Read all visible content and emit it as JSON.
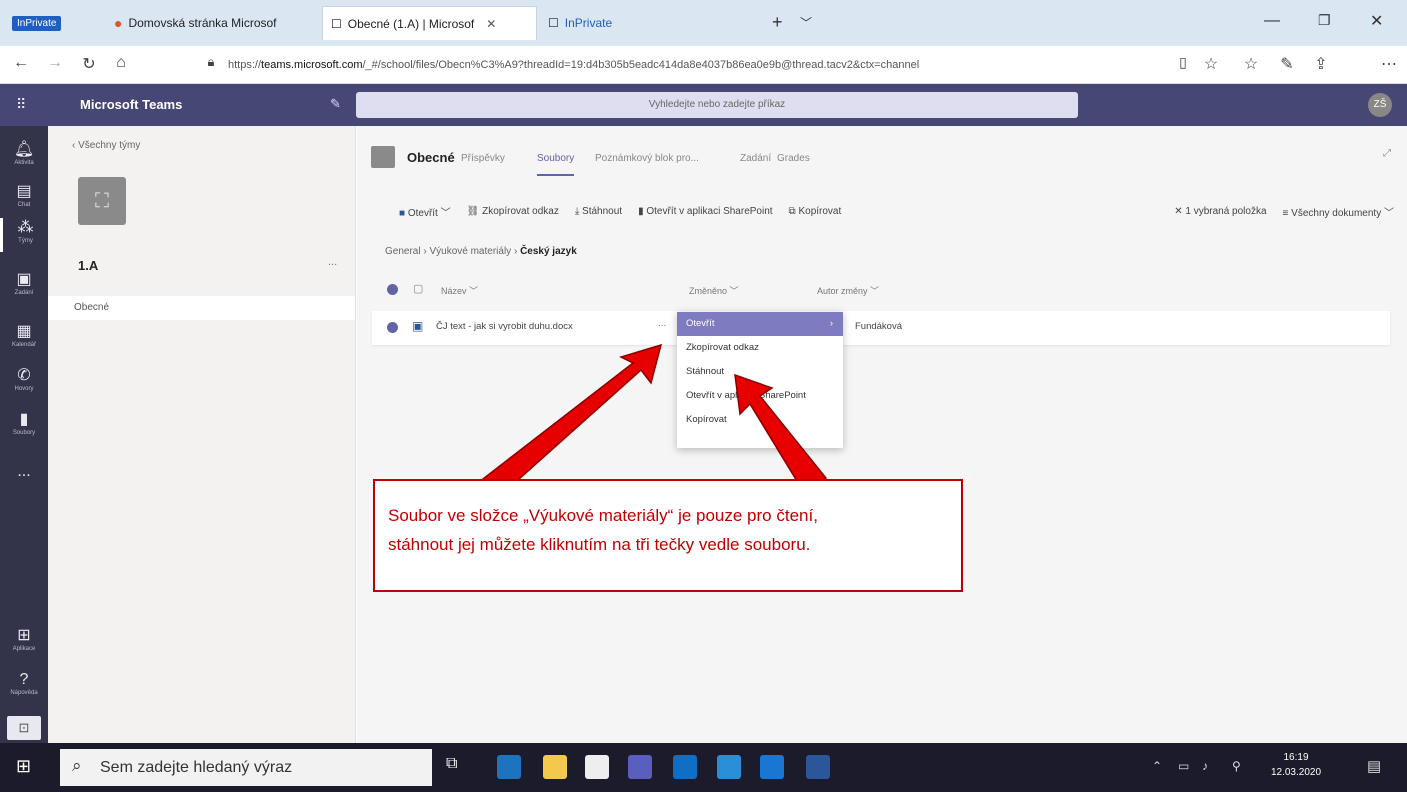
{
  "browser": {
    "tabs": [
      {
        "label": "InPrivate",
        "badge": true
      },
      {
        "label": "Domovská stránka Microsof"
      },
      {
        "label": "Obecné (1.A) | Microsof"
      },
      {
        "label": "InPrivate",
        "badge": true
      }
    ],
    "url_prefix": "https://",
    "url_domain": "teams.microsoft.com",
    "url_rest": "/_#/school/files/Obecn%C3%A9?threadId=19:d4b305b5eadc414da8e4037b86ea0e9b@thread.tacv2&ctx=channel"
  },
  "teams": {
    "app_name": "Microsoft Teams",
    "command_placeholder": "Vyhledejte nebo zadejte příkaz",
    "avatar_initials": "ZŠ",
    "rail": [
      "Aktivita",
      "Chat",
      "Týmy",
      "Zadání",
      "Kalendář",
      "Hovory",
      "Soubory",
      "...",
      "Aplikace",
      "Nápověda"
    ],
    "back_link": "Všechny týmy",
    "team_name": "1.A",
    "team_more": "...",
    "channel": "Obecné"
  },
  "channel": {
    "title": "Obecné",
    "tabs": [
      "Příspěvky",
      "Soubory",
      "Poznámkový blok pro...",
      "Zadání",
      "Grades"
    ],
    "active_tab": "Soubory",
    "toolbar": {
      "open": "Otevřít",
      "copy_link": "Zkopírovat odkaz",
      "download": "Stáhnout",
      "open_sharepoint": "Otevřít v aplikaci SharePoint",
      "copy": "Kopírovat",
      "selected": "1 vybraná položka",
      "all_docs": "Všechny dokumenty"
    },
    "breadcrumb": [
      "General",
      "Výukové materiály",
      "Český jazyk"
    ],
    "columns": {
      "name": "Název",
      "modified": "Změněno",
      "author": "Autor změny"
    },
    "file": {
      "name": "ČJ text - jak si vyrobit duhu.docx",
      "more": "...",
      "author": "Fundáková"
    }
  },
  "context_menu": [
    "Otevřít",
    "Zkopírovat odkaz",
    "Stáhnout",
    "Otevřít v aplikaci SharePoint",
    "Kopírovat"
  ],
  "callout": {
    "line1": "Soubor ve složce „Výukové materiály“ je pouze pro čtení,",
    "line2": "stáhnout jej můžete kliknutím na tři tečky vedle souboru."
  },
  "taskbar": {
    "search_placeholder": "Sem zadejte hledaný výraz",
    "time": "16:19",
    "date": "12.03.2020"
  },
  "colors": {
    "teams_purple": "#464775",
    "callout_red": "#c00000",
    "menu_highlight": "#7f7bc0"
  }
}
